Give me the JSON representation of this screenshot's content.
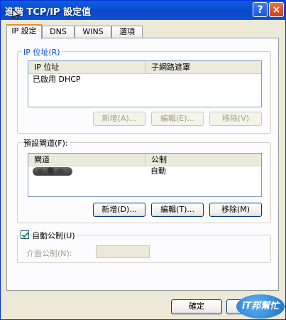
{
  "window": {
    "title": "進階 TCP/IP 設定值",
    "help_label": "?",
    "close_label": "×"
  },
  "tabs": [
    {
      "label": "IP 設定"
    },
    {
      "label": "DNS"
    },
    {
      "label": "WINS"
    },
    {
      "label": "選項"
    }
  ],
  "ip_section": {
    "group_label": "IP 位址(R)",
    "columns": [
      "IP 位址",
      "子網路遮罩"
    ],
    "rows": [
      [
        "已啟用 DHCP",
        ""
      ]
    ],
    "buttons": {
      "add": "新增(A)...",
      "edit": "編輯(E)...",
      "remove": "移除(V)"
    }
  },
  "gateway_section": {
    "group_label": "預設閘道(F):",
    "columns": [
      "閘道",
      "公制"
    ],
    "rows": [
      [
        "",
        "自動"
      ]
    ],
    "buttons": {
      "add": "新增(D)...",
      "edit": "編輯(T)...",
      "remove": "移除(M)"
    }
  },
  "metric": {
    "auto_label": "自動公制(U)",
    "auto_checked": true,
    "interface_label": "介面公制(N):",
    "interface_value": ""
  },
  "footer": {
    "ok": "確定",
    "cancel_partial": "",
    "logo_text": "iT邦幫忙"
  }
}
